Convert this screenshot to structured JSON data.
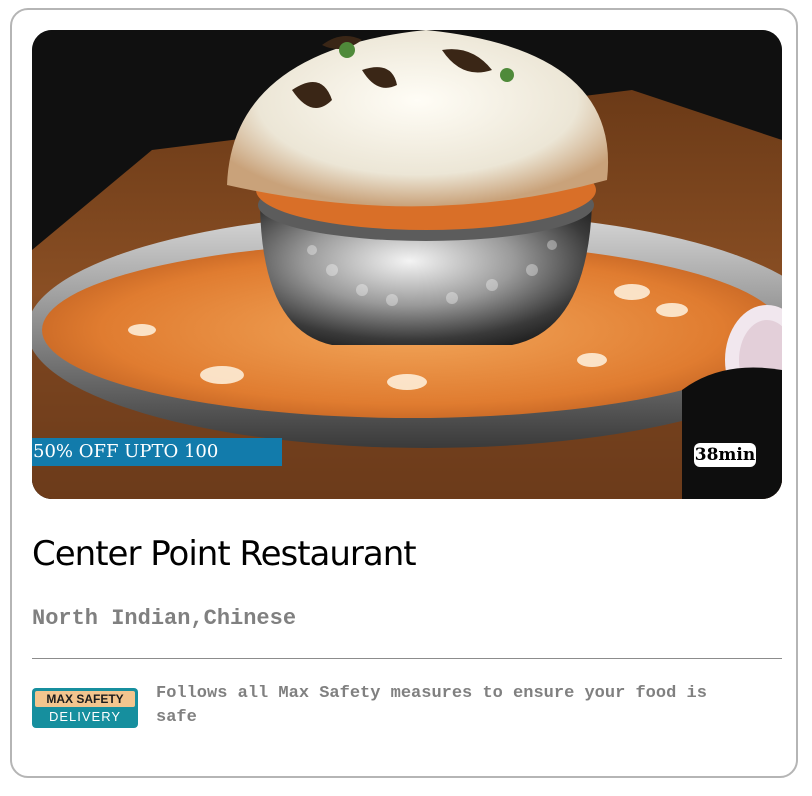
{
  "restaurant": {
    "name": "Center Point Restaurant",
    "cuisines": "North Indian,Chinese"
  },
  "image": {
    "subject": "biryani-bowl-photo"
  },
  "badges": {
    "offer": "50% OFF UPTO 100",
    "delivery_time": "38min"
  },
  "safety": {
    "logo_top": "MAX SAFETY",
    "logo_bottom": "DELIVERY",
    "message": "Follows all Max Safety measures to ensure your food is safe"
  },
  "colors": {
    "offer_badge_bg": "#127bab",
    "safety_logo_bg": "#168f9e",
    "safety_logo_accent": "#f3c58e",
    "secondary_text": "#808080"
  }
}
